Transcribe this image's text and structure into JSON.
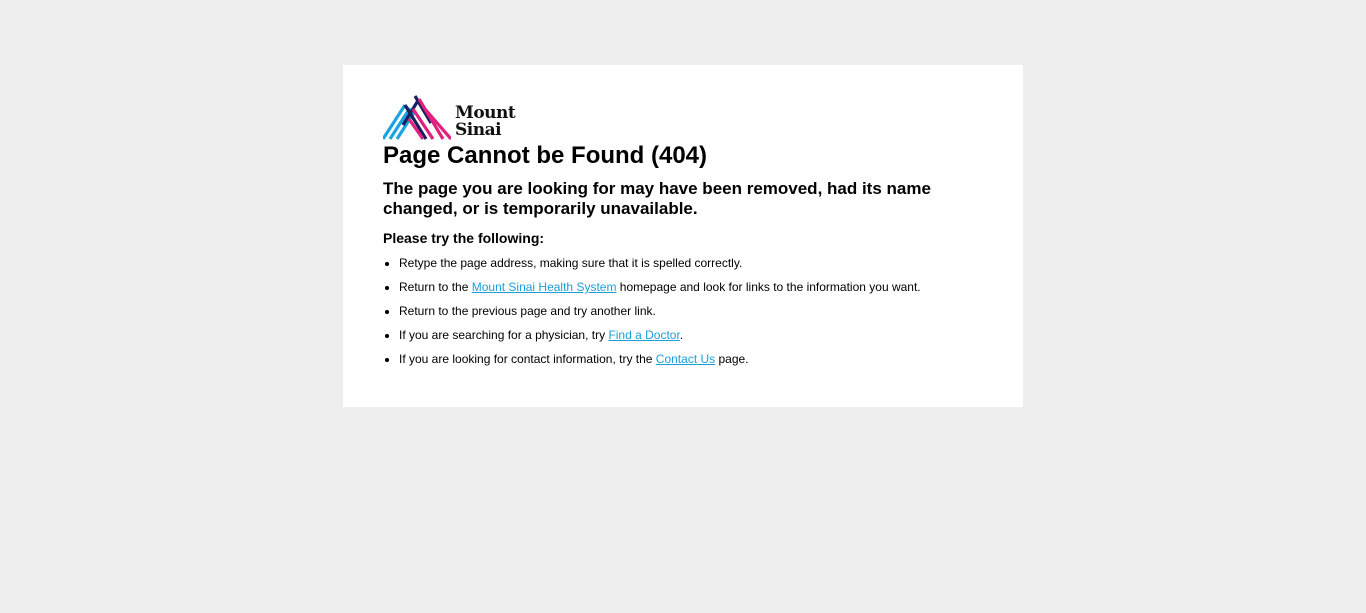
{
  "brand": {
    "name_line1": "Mount",
    "name_line2": "Sinai",
    "colors": {
      "cyan": "#1aa3e0",
      "magenta": "#e0227e",
      "navy": "#1b1f5e"
    }
  },
  "heading": "Page Cannot be Found (404)",
  "subheading": "The page you are looking for may have been removed, had its name changed, or is temporarily unavailable.",
  "instructions_title": "Please try the following:",
  "items": [
    {
      "text": "Retype the page address, making sure that it is spelled correctly."
    },
    {
      "before": "Return to the ",
      "link": "Mount Sinai Health System",
      "after": " homepage and look for links to the information you want."
    },
    {
      "text": "Return to the previous page and try another link."
    },
    {
      "before": "If you are searching for a physician, try ",
      "link": "Find a Doctor",
      "after": "."
    },
    {
      "before": "If you are looking for contact information, try the ",
      "link": "Contact Us",
      "after": " page."
    }
  ],
  "link_color": "#1a9fd8",
  "background_color": "#eeeeee"
}
